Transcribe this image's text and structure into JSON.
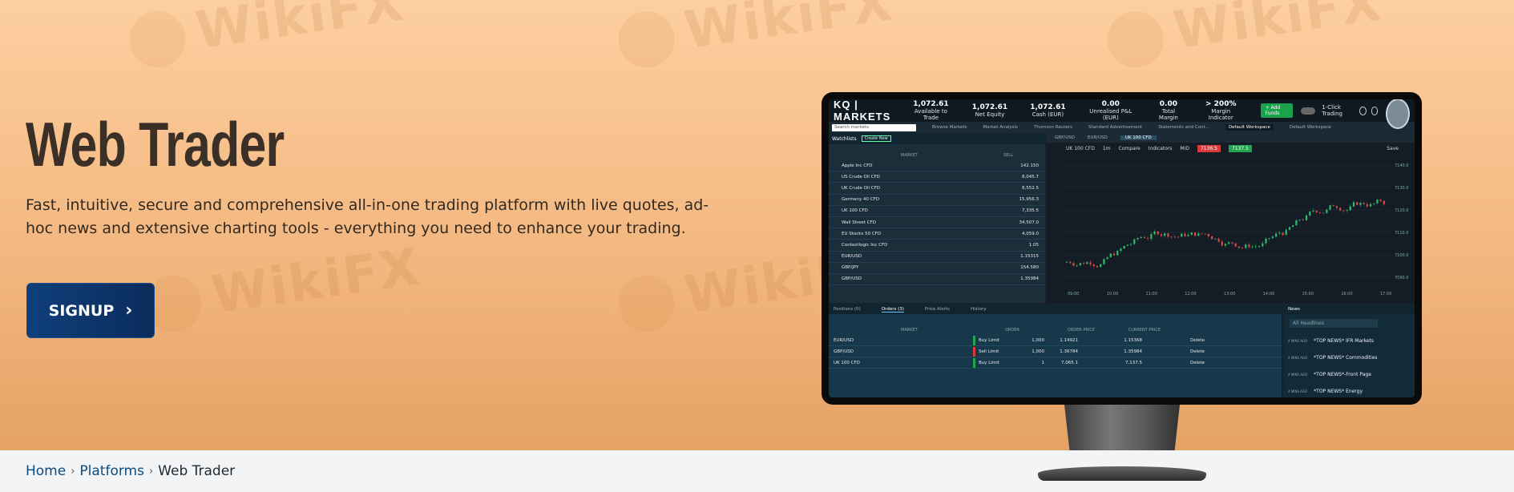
{
  "hero": {
    "title": "Web Trader",
    "description": "Fast, intuitive, secure and comprehensive all-in-one trading platform with live quotes, ad-hoc news and extensive charting tools - everything you need to enhance your trading.",
    "signup_label": "SIGNUP",
    "watermark_text": "WikiFX"
  },
  "platform": {
    "brand": "KQ | MARKETS",
    "stats": [
      {
        "value": "1,072.61",
        "label": "Available to Trade"
      },
      {
        "value": "1,072.61",
        "label": "Net Equity"
      },
      {
        "value": "1,072.61",
        "label": "Cash (EUR)"
      },
      {
        "value": "0.00",
        "label": "Unrealised P&L (EUR)"
      },
      {
        "value": "0.00",
        "label": "Total Margin"
      },
      {
        "value": "> 200%",
        "label": "Margin Indicator"
      }
    ],
    "add_funds": "+ Add Funds",
    "one_click": "1-Click Trading",
    "search_placeholder": "Search markets",
    "workspace_tabs": [
      "Browse Markets",
      "Market Analysis",
      "Thomson Reuters",
      "Standard Advertisement",
      "Statements and Cont...",
      "Default Workspace",
      "Default Workspace"
    ],
    "watchlist_label": "Watchlists",
    "create_new": "Create New",
    "col_market": "MARKET",
    "col_sell": "SELL",
    "watchlist": [
      {
        "name": "Apple Inc CFD",
        "price": "142.150"
      },
      {
        "name": "US Crude Oil CFD",
        "price": "8,045.7"
      },
      {
        "name": "UK Crude Oil CFD",
        "price": "8,552.5"
      },
      {
        "name": "Germany 40 CFD",
        "price": "15,956.3"
      },
      {
        "name": "UK 100 CFD",
        "price": "7,335.5"
      },
      {
        "name": "Wall Street CFD",
        "price": "34,507.0"
      },
      {
        "name": "EU Stocks 50 CFD",
        "price": "4,059.0"
      },
      {
        "name": "Contextlogic Inc CFD",
        "price": "1.05"
      },
      {
        "name": "EUR/USD",
        "price": "1.15315"
      },
      {
        "name": "GBP/JPY",
        "price": "154.580"
      },
      {
        "name": "GBP/USD",
        "price": "1.35984"
      }
    ],
    "chart_tabs": [
      "GBP/USD",
      "EUR/USD",
      "UK 100 CFD"
    ],
    "chart_instrument": "UK 100 CFD",
    "chart_interval": "1m",
    "compare": "Compare",
    "indicators": "Indicators",
    "sell_price": "7136.5",
    "buy_price": "7137.5",
    "mid": "MID",
    "save": "Save",
    "order_tabs": [
      "Positions (0)",
      "Orders (3)",
      "Price Alerts",
      "History"
    ],
    "order_cols": [
      "MARKET",
      "ORDER",
      "ORDER PRICE",
      "CURRENT PRICE"
    ],
    "orders": [
      {
        "market": "EUR/USD",
        "side": "Buy Limit",
        "qty": "1,000",
        "order_price": "1.14921",
        "current": "1.15368",
        "action": "Delete",
        "color": "#23a44f"
      },
      {
        "market": "GBP/USD",
        "side": "Sell Limit",
        "qty": "1,000",
        "order_price": "1.36784",
        "current": "1.35984",
        "action": "Delete",
        "color": "#d93b3b"
      },
      {
        "market": "UK 100 CFD",
        "side": "Buy Limit",
        "qty": "1",
        "order_price": "7,065.1",
        "current": "7,137.5",
        "action": "Delete",
        "color": "#23a44f"
      }
    ],
    "news_tab": "News",
    "news_search": "All Headlines",
    "news": [
      {
        "time": "4 MINS AGO",
        "headline": "*TOP NEWS* IFR Markets"
      },
      {
        "time": "4 MINS AGO",
        "headline": "*TOP NEWS* Commodities"
      },
      {
        "time": "4 MINS AGO",
        "headline": "*TOP NEWS*-Front Page"
      },
      {
        "time": "4 MINS AGO",
        "headline": "*TOP NEWS* Energy"
      }
    ],
    "y_labels": [
      "7140.0",
      "7130.0",
      "7120.0",
      "7110.0",
      "7100.0",
      "7090.0"
    ],
    "x_labels": [
      "09:00",
      "10:00",
      "11:00",
      "12:00",
      "13:00",
      "14:00",
      "15:00",
      "16:00",
      "17:00"
    ]
  },
  "breadcrumb": {
    "home": "Home",
    "platforms": "Platforms",
    "current": "Web Trader"
  },
  "colors": {
    "hero_top": "#fdcfa0",
    "hero_bottom": "#e5a264",
    "signup_bg": "#0f3f7a",
    "link": "#0d4a7c"
  }
}
